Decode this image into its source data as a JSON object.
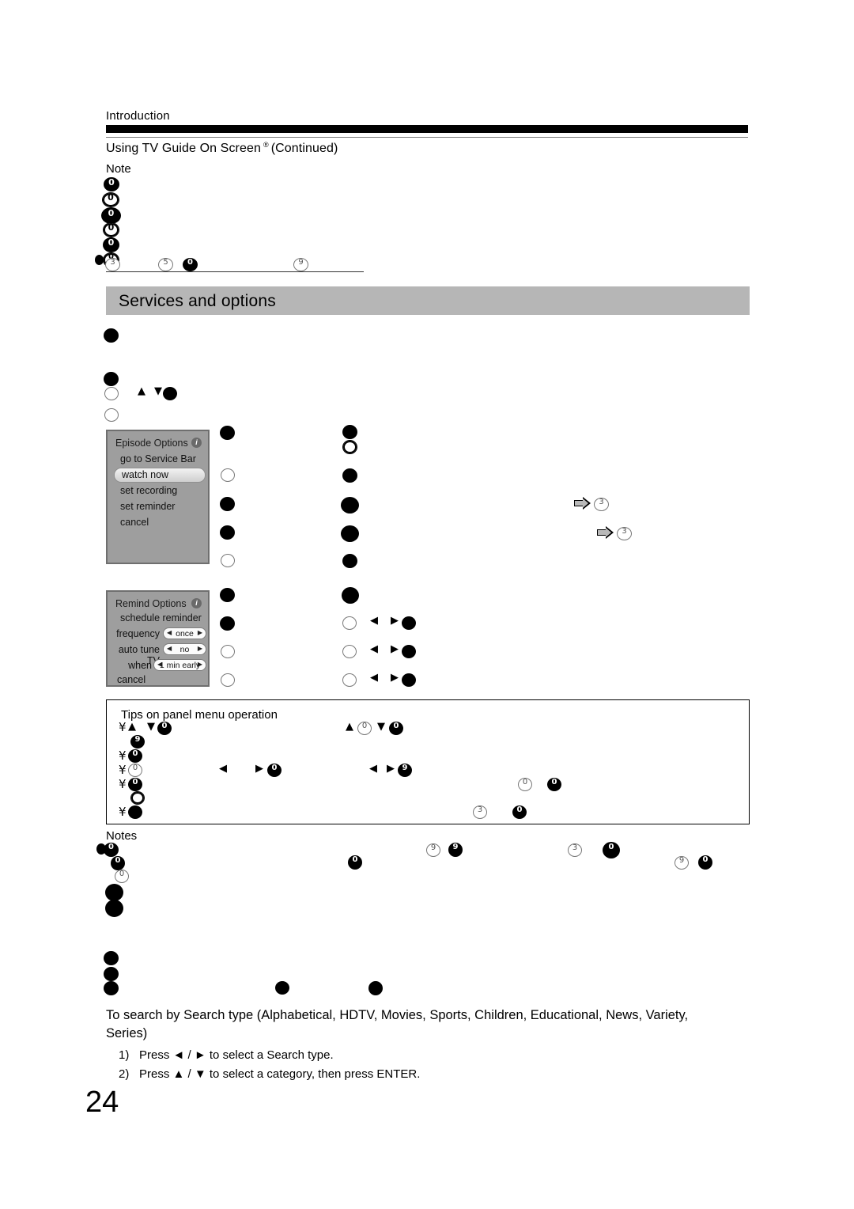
{
  "page": {
    "section_label": "Introduction",
    "chapter_title_before": "Using TV Guide On Screen",
    "chapter_title_tm": "®",
    "chapter_title_after": "(Continued)",
    "note_heading": "Note",
    "notes_heading": "Notes",
    "page_number": "24",
    "band_color": "#b6b6b6",
    "rule_color": "#000000"
  },
  "services_section": {
    "title": "Services and options"
  },
  "episode_panel": {
    "title": "Episode Options",
    "info_icon": "i",
    "items": [
      "go to Service Bar",
      "watch now",
      "set recording",
      "set reminder",
      "cancel"
    ],
    "highlighted_item": "watch now"
  },
  "remind_panel": {
    "title": "Remind Options",
    "info_icon": "i",
    "header_item": "schedule reminder",
    "settings": [
      {
        "label": "frequency",
        "value": "once"
      },
      {
        "label": "auto tune TV",
        "value": "no"
      },
      {
        "label": "when",
        "value": "1 min early"
      }
    ],
    "cancel_item": "cancel"
  },
  "tips_box": {
    "title": "Tips on panel menu operation"
  },
  "search_section": {
    "heading": "To search by Search type (Alphabetical, HDTV, Movies, Sports, Children, Educational, News, Variety, Series)",
    "steps": [
      {
        "num": "1)",
        "text_before": "Press",
        "keys": "◄ / ►",
        "text_after": "to select a Search type."
      },
      {
        "num": "2)",
        "text_before": "Press",
        "keys": "▲ / ▼",
        "text_after": "to select a category, then press ENTER."
      }
    ]
  },
  "page_refs": [
    {
      "arrow": "right-arrow-icon",
      "marker": "3"
    },
    {
      "arrow": "right-arrow-icon",
      "marker": "3"
    }
  ],
  "unrendered_glyphs": {
    "description": "Body text failed to render and appears as garbled circled glyph blobs",
    "note_column": [
      "0",
      "0",
      "0",
      "0",
      "0",
      "0"
    ],
    "note_row_markers": [
      "3",
      "5",
      "0",
      "9"
    ],
    "tips_markers": [
      "0",
      "0",
      "0",
      "9",
      "0",
      "0",
      "0",
      "9",
      "0",
      "0",
      "0",
      "3",
      "0"
    ],
    "notes_markers": [
      "0",
      "0",
      "9",
      "9",
      "0",
      "3",
      "0",
      "0",
      "9",
      "0"
    ]
  }
}
